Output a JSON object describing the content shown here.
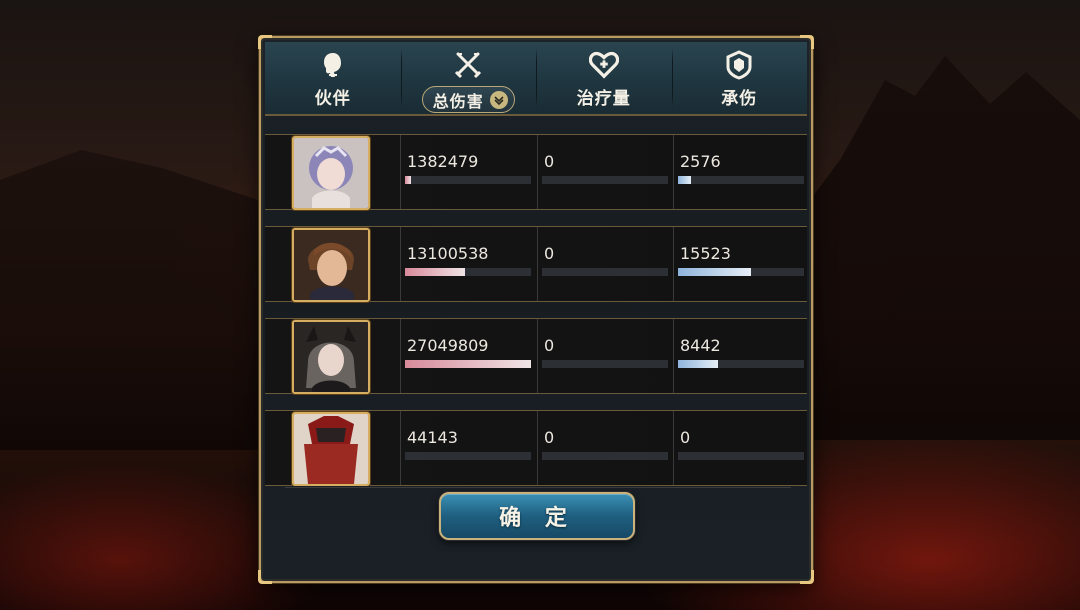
{
  "tabs": [
    {
      "id": "partner",
      "label": "伙伴",
      "icon": "head-silhouette-icon"
    },
    {
      "id": "damage",
      "label": "总伤害",
      "icon": "crossed-swords-icon",
      "dropdown": true
    },
    {
      "id": "healing",
      "label": "治疗量",
      "icon": "heart-plus-icon"
    },
    {
      "id": "taken",
      "label": "承伤",
      "icon": "shield-icon"
    }
  ],
  "rows": [
    {
      "damage": "1382479",
      "healing": "0",
      "taken": "2576",
      "damage_ratio": 0.05,
      "healing_ratio": 0,
      "taken_ratio": 0.1,
      "portrait": "lavender-haired-girl-portrait"
    },
    {
      "damage": "13100538",
      "healing": "0",
      "taken": "15523",
      "damage_ratio": 0.48,
      "healing_ratio": 0,
      "taken_ratio": 0.58,
      "portrait": "brown-haired-man-portrait"
    },
    {
      "damage": "27049809",
      "healing": "0",
      "taken": "8442",
      "damage_ratio": 1.0,
      "healing_ratio": 0,
      "taken_ratio": 0.32,
      "portrait": "horned-gray-haired-woman-portrait"
    },
    {
      "damage": "44143",
      "healing": "0",
      "taken": "0",
      "damage_ratio": 0.0,
      "healing_ratio": 0,
      "taken_ratio": 0,
      "portrait": "red-armored-warrior-portrait"
    }
  ],
  "confirm_label": "确 定",
  "colors": {
    "damage_bar": "#d88a9a",
    "taken_bar": "#8fb4dc",
    "frame_gold": "#b89a62"
  }
}
